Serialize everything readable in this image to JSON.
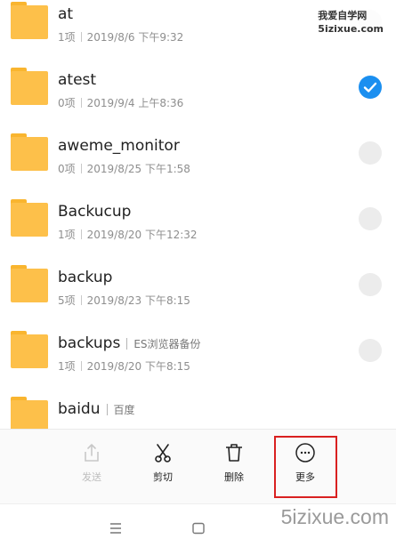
{
  "watermark": {
    "line1": "我爱自学网",
    "line2": "5izixue.com",
    "bottom": "5izixue.com"
  },
  "files": [
    {
      "name": "at",
      "tag": "",
      "count": "1项",
      "date": "2019/8/6 下午9:32",
      "checked": false
    },
    {
      "name": "atest",
      "tag": "",
      "count": "0项",
      "date": "2019/9/4 上午8:36",
      "checked": true
    },
    {
      "name": "aweme_monitor",
      "tag": "",
      "count": "0项",
      "date": "2019/8/25 下午1:58",
      "checked": false
    },
    {
      "name": "Backucup",
      "tag": "",
      "count": "1项",
      "date": "2019/8/20 下午12:32",
      "checked": false
    },
    {
      "name": "backup",
      "tag": "",
      "count": "5项",
      "date": "2019/8/23 下午8:15",
      "checked": false
    },
    {
      "name": "backups",
      "tag": "ES浏览器备份",
      "count": "1项",
      "date": "2019/8/20 下午8:15",
      "checked": false
    },
    {
      "name": "baidu",
      "tag": "百度",
      "count": "",
      "date": "",
      "checked": false
    }
  ],
  "actions": {
    "send": "发送",
    "cut": "剪切",
    "delete": "删除",
    "more": "更多"
  },
  "colors": {
    "accent": "#1b8ff0",
    "folder": "#fdc04a",
    "highlight": "#d92020"
  }
}
